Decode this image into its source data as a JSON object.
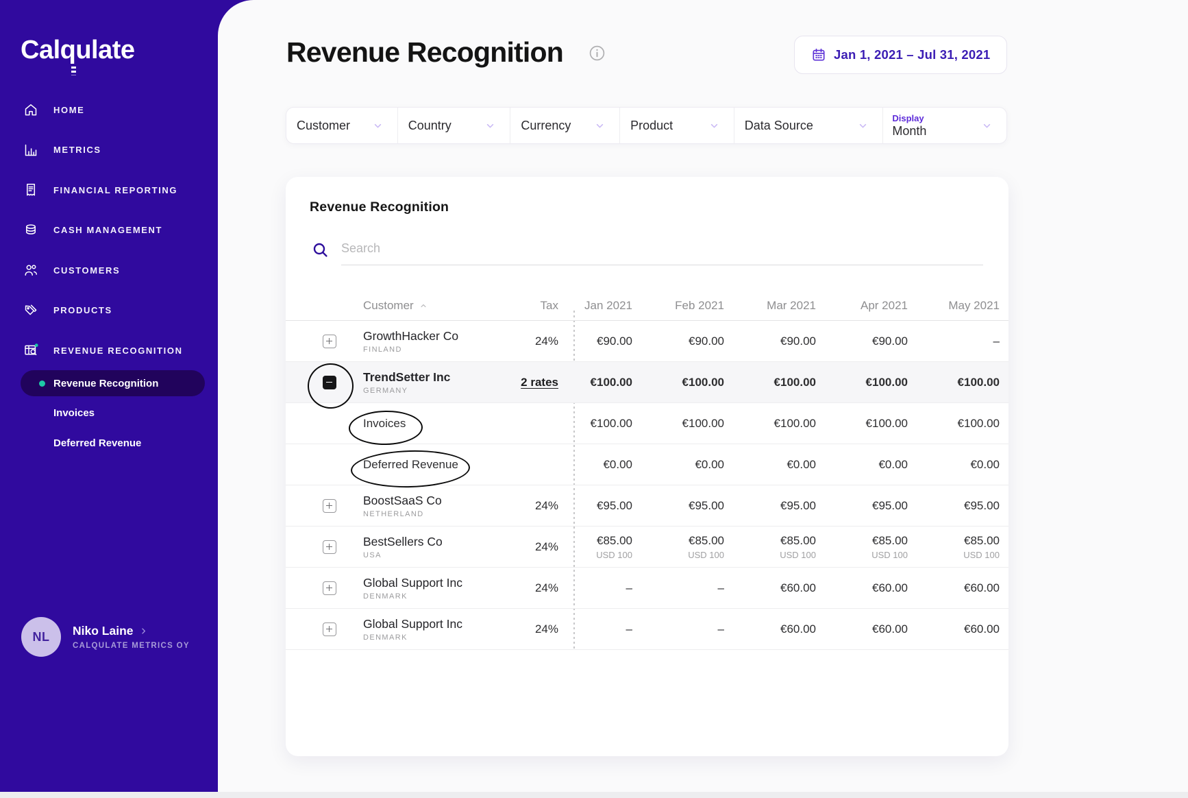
{
  "colors": {
    "sidebar_bg": "#300A9E",
    "active_pill": "#21035C",
    "teal_accent": "#1EC9A7",
    "purple_accent": "#5B2FD6",
    "date_text": "#3B1DB4",
    "display_label": "#5D2BD9"
  },
  "sidebar": {
    "logo": "Calqulate",
    "items": [
      {
        "label": "HOME",
        "icon": "home-icon"
      },
      {
        "label": "METRICS",
        "icon": "metrics-icon"
      },
      {
        "label": "FINANCIAL REPORTING",
        "icon": "financial-reporting-icon"
      },
      {
        "label": "CASH MANAGEMENT",
        "icon": "cash-management-icon"
      },
      {
        "label": "CUSTOMERS",
        "icon": "customers-icon"
      },
      {
        "label": "PRODUCTS",
        "icon": "products-icon"
      },
      {
        "label": "REVENUE RECOGNITION",
        "icon": "revenue-recognition-icon",
        "badge": true
      }
    ],
    "submenu": [
      {
        "label": "Revenue Recognition",
        "active": true
      },
      {
        "label": "Invoices",
        "active": false
      },
      {
        "label": "Deferred Revenue",
        "active": false
      }
    ],
    "user": {
      "initials": "NL",
      "name": "Niko Laine",
      "company": "CALQULATE METRICS OY"
    }
  },
  "header": {
    "title": "Revenue Recognition",
    "date_range": "Jan 1, 2021 – Jul 31, 2021"
  },
  "filters": [
    {
      "label": "Customer"
    },
    {
      "label": "Country"
    },
    {
      "label": "Currency"
    },
    {
      "label": "Product"
    },
    {
      "label": "Data Source"
    },
    {
      "label": "Month",
      "overline": "Display"
    }
  ],
  "panel": {
    "title": "Revenue Recognition",
    "search_placeholder": "Search",
    "columns": [
      "Customer",
      "Tax",
      "Jan 2021",
      "Feb 2021",
      "Mar 2021",
      "Apr 2021",
      "May 2021"
    ],
    "rows": [
      {
        "kind": "company",
        "expander": "plus",
        "name": "GrowthHacker Co",
        "country": "FINLAND",
        "tax": "24%",
        "values": [
          "€90.00",
          "€90.00",
          "€90.00",
          "€90.00",
          "–"
        ]
      },
      {
        "kind": "company",
        "expander": "minus",
        "name": "TrendSetter Inc",
        "country": "GERMANY",
        "tax": "2 rates",
        "tax_link": true,
        "bold": true,
        "highlight": true,
        "values": [
          "€100.00",
          "€100.00",
          "€100.00",
          "€100.00",
          "€100.00"
        ]
      },
      {
        "kind": "sub",
        "name": "Invoices",
        "values": [
          "€100.00",
          "€100.00",
          "€100.00",
          "€100.00",
          "€100.00"
        ]
      },
      {
        "kind": "sub",
        "name": "Deferred Revenue",
        "values": [
          "€0.00",
          "€0.00",
          "€0.00",
          "€0.00",
          "€0.00"
        ]
      },
      {
        "kind": "company",
        "expander": "plus",
        "name": "BoostSaaS Co",
        "country": "NETHERLAND",
        "tax": "24%",
        "values": [
          "€95.00",
          "€95.00",
          "€95.00",
          "€95.00",
          "€95.00"
        ]
      },
      {
        "kind": "company",
        "expander": "plus",
        "name": "BestSellers Co",
        "country": "USA",
        "tax": "24%",
        "values": [
          "€85.00",
          "€85.00",
          "€85.00",
          "€85.00",
          "€85.00"
        ],
        "subvalues": [
          "USD 100",
          "USD 100",
          "USD 100",
          "USD 100",
          "USD 100"
        ]
      },
      {
        "kind": "company",
        "expander": "plus",
        "name": "Global Support Inc",
        "country": "DENMARK",
        "tax": "24%",
        "values": [
          "–",
          "–",
          "€60.00",
          "€60.00",
          "€60.00"
        ]
      },
      {
        "kind": "company",
        "expander": "plus",
        "name": "Global Support Inc",
        "country": "DENMARK",
        "tax": "24%",
        "values": [
          "–",
          "–",
          "€60.00",
          "€60.00",
          "€60.00"
        ]
      }
    ]
  }
}
